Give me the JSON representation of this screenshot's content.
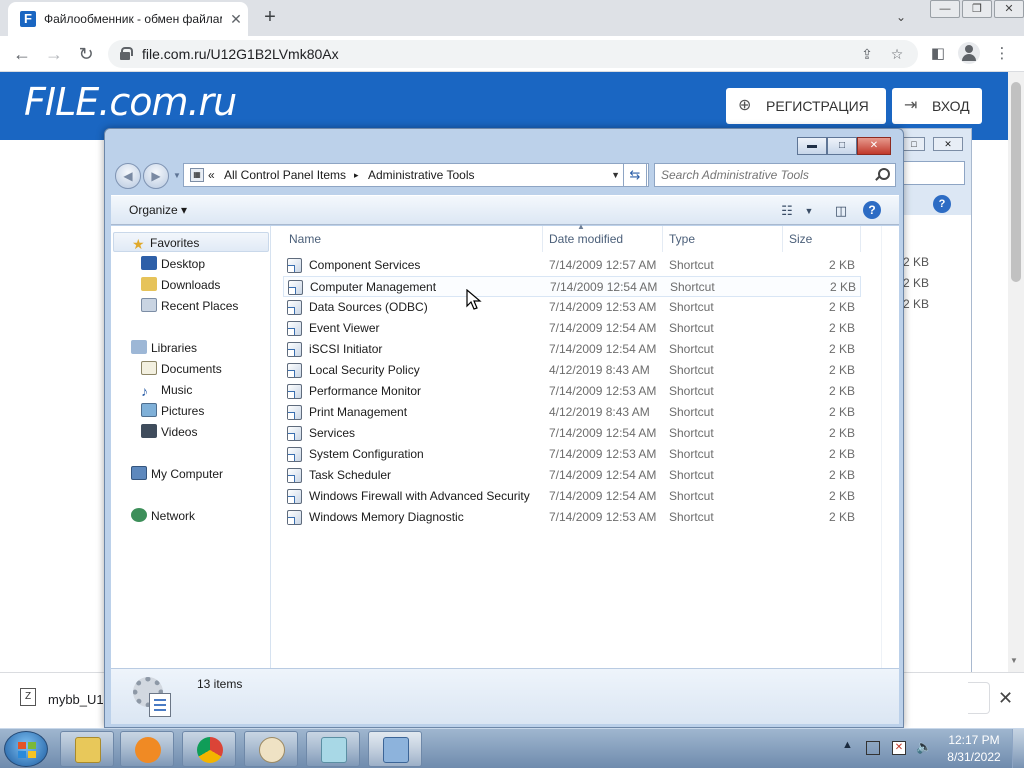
{
  "browser": {
    "tab_title": "Файлообменник - обмен файлами",
    "tab_favicon": "F",
    "tab_close": "✕",
    "new_tab": "+",
    "url": "file.com.ru/U12G1B2LVmk80Ax",
    "window_minimize": "—",
    "window_restore": "❐",
    "window_close": "✕",
    "tab_search": "⌄"
  },
  "site": {
    "logo": "FILE.com.ru",
    "register_label": "РЕГИСТРАЦИЯ",
    "register_icon": "⊕",
    "login_label": "ВХОД",
    "login_icon": "⇥"
  },
  "download": {
    "icon": "Z",
    "filename": "mybb_U1",
    "close": "✕"
  },
  "background_window": {
    "sizes": [
      "2 KB",
      "2 KB",
      "2 KB"
    ]
  },
  "explorer": {
    "title_buttons": {
      "minimize": "▬",
      "maximize": "□",
      "close": "✕"
    },
    "breadcrumb": {
      "prefix": "«",
      "items": [
        "All Control Panel Items",
        "Administrative Tools"
      ],
      "separator": "▸"
    },
    "search_placeholder": "Search Administrative Tools",
    "organize_label": "Organize ▾",
    "columns": {
      "name": "Name",
      "date": "Date modified",
      "type": "Type",
      "size": "Size"
    },
    "nav": {
      "favorites": "Favorites",
      "desktop": "Desktop",
      "downloads": "Downloads",
      "recent": "Recent Places",
      "libraries": "Libraries",
      "documents": "Documents",
      "music": "Music",
      "pictures": "Pictures",
      "videos": "Videos",
      "computer": "My Computer",
      "network": "Network"
    },
    "files": [
      {
        "name": "Component Services",
        "date": "7/14/2009 12:57 AM",
        "type": "Shortcut",
        "size": "2 KB"
      },
      {
        "name": "Computer Management",
        "date": "7/14/2009 12:54 AM",
        "type": "Shortcut",
        "size": "2 KB"
      },
      {
        "name": "Data Sources (ODBC)",
        "date": "7/14/2009 12:53 AM",
        "type": "Shortcut",
        "size": "2 KB"
      },
      {
        "name": "Event Viewer",
        "date": "7/14/2009 12:54 AM",
        "type": "Shortcut",
        "size": "2 KB"
      },
      {
        "name": "iSCSI Initiator",
        "date": "7/14/2009 12:54 AM",
        "type": "Shortcut",
        "size": "2 KB"
      },
      {
        "name": "Local Security Policy",
        "date": "4/12/2019 8:43 AM",
        "type": "Shortcut",
        "size": "2 KB"
      },
      {
        "name": "Performance Monitor",
        "date": "7/14/2009 12:53 AM",
        "type": "Shortcut",
        "size": "2 KB"
      },
      {
        "name": "Print Management",
        "date": "4/12/2019 8:43 AM",
        "type": "Shortcut",
        "size": "2 KB"
      },
      {
        "name": "Services",
        "date": "7/14/2009 12:54 AM",
        "type": "Shortcut",
        "size": "2 KB"
      },
      {
        "name": "System Configuration",
        "date": "7/14/2009 12:53 AM",
        "type": "Shortcut",
        "size": "2 KB"
      },
      {
        "name": "Task Scheduler",
        "date": "7/14/2009 12:54 AM",
        "type": "Shortcut",
        "size": "2 KB"
      },
      {
        "name": "Windows Firewall with Advanced Security",
        "date": "7/14/2009 12:54 AM",
        "type": "Shortcut",
        "size": "2 KB"
      },
      {
        "name": "Windows Memory Diagnostic",
        "date": "7/14/2009 12:53 AM",
        "type": "Shortcut",
        "size": "2 KB"
      }
    ],
    "status": "13 items"
  },
  "taskbar": {
    "time": "12:17 PM",
    "date": "8/31/2022",
    "tray_arrow": "▲",
    "apps": [
      "explorer",
      "media-player",
      "chrome",
      "paint",
      "notepad",
      "control-panel"
    ]
  },
  "colors": {
    "site_blue": "#1a66c2",
    "explorer_frame": "#bcd1ea",
    "taskbar": "#6f8bad"
  }
}
